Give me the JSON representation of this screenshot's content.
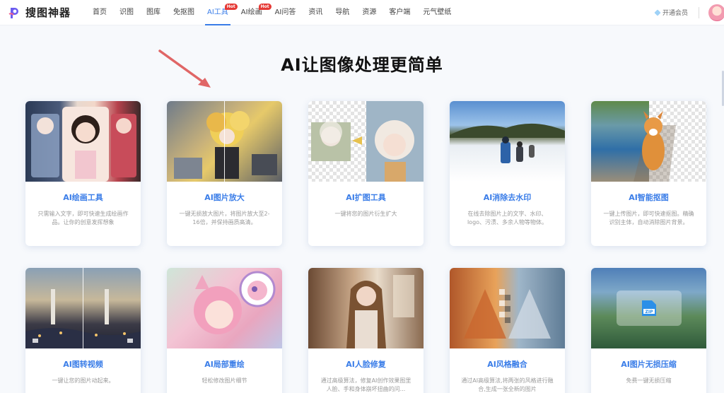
{
  "header": {
    "logo_text": "搜图神器",
    "nav": [
      {
        "label": "首页",
        "hot": false,
        "active": false
      },
      {
        "label": "识图",
        "hot": false,
        "active": false
      },
      {
        "label": "图库",
        "hot": false,
        "active": false
      },
      {
        "label": "免抠图",
        "hot": false,
        "active": false
      },
      {
        "label": "AI工具",
        "hot": true,
        "active": true
      },
      {
        "label": "AI绘画",
        "hot": true,
        "active": false
      },
      {
        "label": "AI问答",
        "hot": false,
        "active": false
      },
      {
        "label": "资讯",
        "hot": false,
        "active": false
      },
      {
        "label": "导航",
        "hot": false,
        "active": false
      },
      {
        "label": "资源",
        "hot": false,
        "active": false
      },
      {
        "label": "客户端",
        "hot": false,
        "active": false
      },
      {
        "label": "元气壁纸",
        "hot": false,
        "active": false
      }
    ],
    "hot_badge": "Hot",
    "vip_label": "开通会员"
  },
  "headline": "AI让图像处理更简单",
  "cards": [
    {
      "title": "AI绘画工具",
      "desc": "只需输入文字，即可快速生成绘画作品。让你的创意发挥想象"
    },
    {
      "title": "AI图片放大",
      "desc": "一键无损放大图片，将图片放大至2-16倍，并保持画质高清。"
    },
    {
      "title": "AI扩图工具",
      "desc": "一键将您的图片衍生扩大"
    },
    {
      "title": "AI消除去水印",
      "desc": "在线去除图片上的文字、水印、logo、污渍、多余人物等物体。"
    },
    {
      "title": "AI智能抠图",
      "desc": "一键上传图片，即可快速抠图。精确识别主体，自动消除图片背景。"
    },
    {
      "title": "AI图转视频",
      "desc": "一键让您的图片动起来。"
    },
    {
      "title": "AI局部重绘",
      "desc": "轻松修改图片细节"
    },
    {
      "title": "AI人脸修复",
      "desc": "通过高级算法，修复AI创作效果图里人脸、手和身体崩坏扭曲的问..."
    },
    {
      "title": "AI风格融合",
      "desc": "通过AI高级算法,将两张的风格进行融合,生成一张全新的图片"
    },
    {
      "title": "AI图片无损压缩",
      "desc": "免费一键无损压缩"
    }
  ],
  "colors": {
    "accent": "#3a7de8",
    "hot": "#e53935",
    "arrow": "#e06666"
  }
}
